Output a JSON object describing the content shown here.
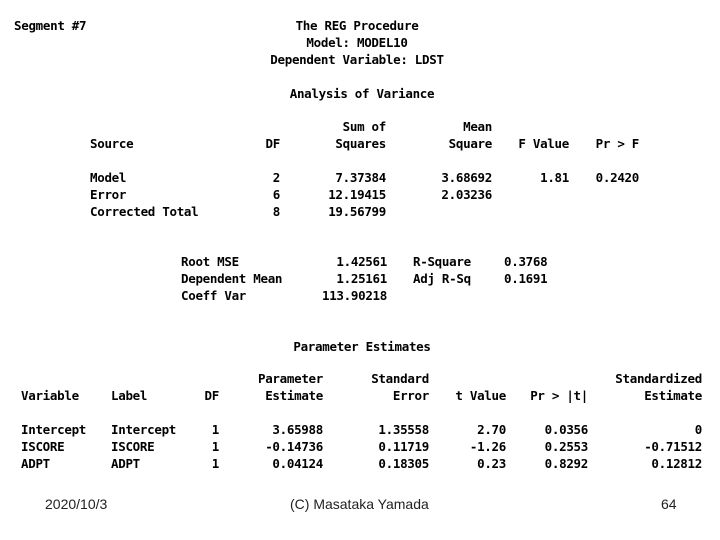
{
  "header": {
    "segment": "Segment #7",
    "procedure": "The REG Procedure",
    "model": "Model: MODEL10",
    "dependent": "Dependent Variable: LDST"
  },
  "anova": {
    "title": "Analysis of Variance",
    "columns": {
      "source": "Source",
      "df": "DF",
      "ss_line1": "Sum of",
      "ss_line2": "Squares",
      "ms_line1": "Mean",
      "ms_line2": "Square",
      "f": "F Value",
      "p": "Pr > F"
    },
    "rows": [
      {
        "source": "Model",
        "df": "2",
        "ss": "7.37384",
        "ms": "3.68692",
        "f": "1.81",
        "p": "0.2420"
      },
      {
        "source": "Error",
        "df": "6",
        "ss": "12.19415",
        "ms": "2.03236",
        "f": "",
        "p": ""
      },
      {
        "source": "Corrected Total",
        "df": "8",
        "ss": "19.56799",
        "ms": "",
        "f": "",
        "p": ""
      }
    ]
  },
  "fit": {
    "rows": [
      {
        "label": "Root MSE",
        "value": "1.42561",
        "label2": "R-Square",
        "value2": "0.3768"
      },
      {
        "label": "Dependent Mean",
        "value": "1.25161",
        "label2": "Adj R-Sq",
        "value2": "0.1691"
      },
      {
        "label": "Coeff Var",
        "value": "113.90218",
        "label2": "",
        "value2": ""
      }
    ]
  },
  "params": {
    "title": "Parameter Estimates",
    "columns": {
      "variable": "Variable",
      "label": "Label",
      "df": "DF",
      "est_line1": "Parameter",
      "est_line2": "Estimate",
      "se_line1": "Standard",
      "se_line2": "Error",
      "t": "t Value",
      "p": "Pr > |t|",
      "std_line1": "Standardized",
      "std_line2": "Estimate"
    },
    "rows": [
      {
        "variable": "Intercept",
        "label": "Intercept",
        "df": "1",
        "estimate": "3.65988",
        "se": "1.35558",
        "t": "2.70",
        "p": "0.0356",
        "std": "0"
      },
      {
        "variable": "ISCORE",
        "label": "ISCORE",
        "df": "1",
        "estimate": "-0.14736",
        "se": "0.11719",
        "t": "-1.26",
        "p": "0.2553",
        "std": "-0.71512"
      },
      {
        "variable": "ADPT",
        "label": "ADPT",
        "df": "1",
        "estimate": "0.04124",
        "se": "0.18305",
        "t": "0.23",
        "p": "0.8292",
        "std": "0.12812"
      }
    ]
  },
  "footer": {
    "date": "2020/10/3",
    "author": "(C) Masataka Yamada",
    "page": "64"
  }
}
